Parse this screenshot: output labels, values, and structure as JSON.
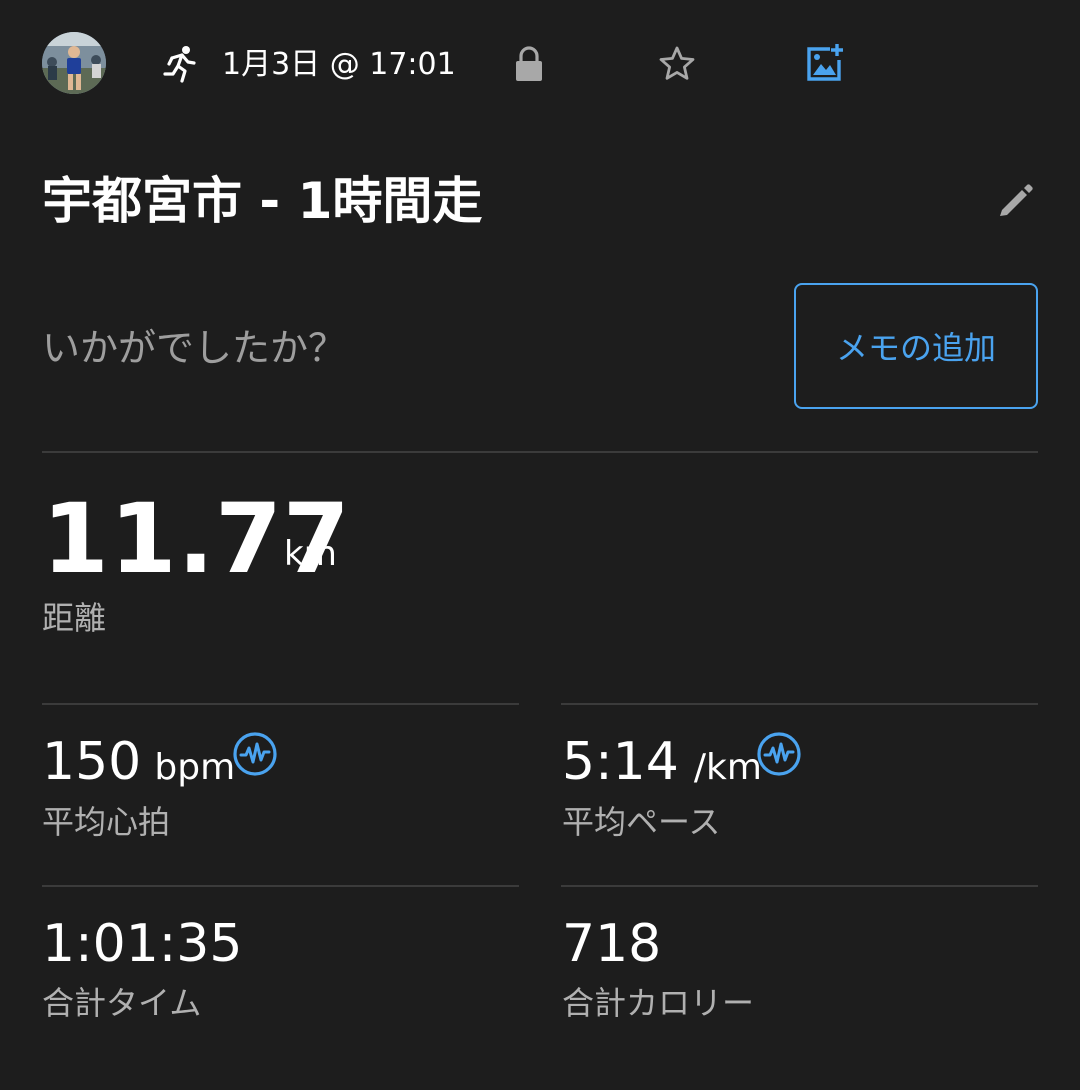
{
  "header": {
    "avatar": "avatar-photo",
    "activity_icon": "running-icon",
    "date": "1月3日 @ 17:01",
    "icons": [
      "lock-icon",
      "star-icon",
      "add-photo-icon"
    ]
  },
  "activity": {
    "title": "宇都宮市 - 1時間走",
    "edit_icon": "pencil-icon"
  },
  "feedback": {
    "prompt": "いかがでしたか？",
    "add_memo_label": "メモの追加"
  },
  "distance": {
    "value": "11.77",
    "unit": "km",
    "label": "距離"
  },
  "stats": {
    "heart_rate": {
      "value": "150",
      "unit": "bpm",
      "label": "平均心拍",
      "icon": "heart-rate-chart-icon"
    },
    "pace": {
      "value": "5:14",
      "unit": "/km",
      "label": "平均ペース",
      "icon": "pace-chart-icon"
    },
    "total_time": {
      "value": "1:01:35",
      "label": "合計タイム"
    },
    "calories": {
      "value": "718",
      "label": "合計カロリー"
    }
  },
  "colors": {
    "background": "#1d1d1d",
    "accent": "#4aa3ef",
    "divider": "#3b3b3b",
    "secondary_text": "#b0b0b0",
    "icon_gray": "#a8a8a8"
  }
}
